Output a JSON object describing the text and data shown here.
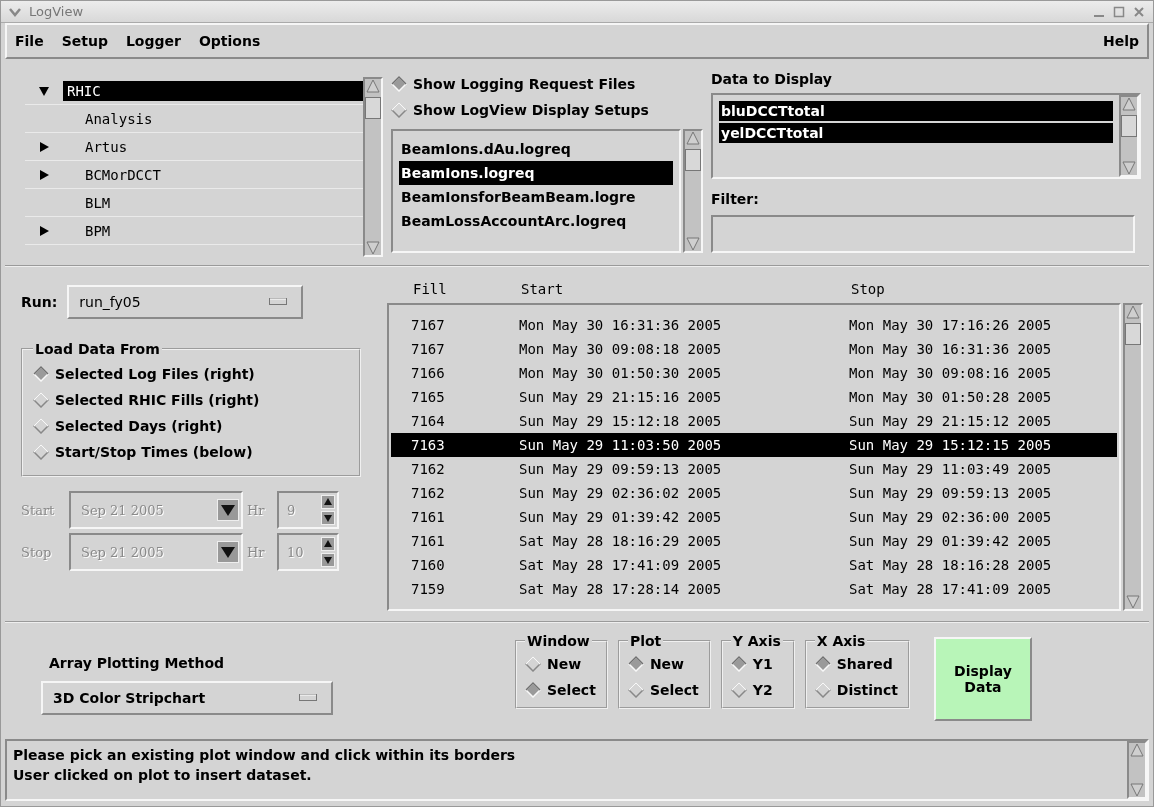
{
  "window": {
    "title": "LogView"
  },
  "menu": [
    {
      "label": "File"
    },
    {
      "label": "Setup"
    },
    {
      "label": "Logger"
    },
    {
      "label": "Options"
    }
  ],
  "help_menu": {
    "label": "Help"
  },
  "tree": [
    {
      "label": "RHIC",
      "selected": true,
      "expanded": true,
      "children": [
        {
          "label": "Analysis",
          "selected": false
        },
        {
          "label": "Artus",
          "selected": false,
          "expanded": false
        },
        {
          "label": "BCMorDCCT",
          "selected": false,
          "expanded": false
        },
        {
          "label": "BLM",
          "selected": false
        },
        {
          "label": "BPM",
          "selected": false,
          "expanded": false
        }
      ]
    }
  ],
  "source_options": [
    {
      "label": "Show Logging Request Files",
      "selected": true
    },
    {
      "label": "Show LogView Display Setups",
      "selected": false
    }
  ],
  "files": [
    {
      "label": "BeamIons.dAu.logreq",
      "selected": false
    },
    {
      "label": "BeamIons.logreq",
      "selected": true
    },
    {
      "label": "BeamIonsforBeamBeam.logre",
      "selected": false
    },
    {
      "label": "BeamLossAccountArc.logreq",
      "selected": false
    }
  ],
  "data_to_display": {
    "label": "Data to Display",
    "items": [
      {
        "label": "bluDCCTtotal",
        "selected": true
      },
      {
        "label": "yelDCCTtotal",
        "selected": true
      }
    ]
  },
  "filter": {
    "label": "Filter:"
  },
  "run": {
    "label": "Run:",
    "value": "run_fy05"
  },
  "load_data_from": {
    "title": "Load Data From",
    "options": [
      {
        "label": "Selected Log Files (right)",
        "selected": true
      },
      {
        "label": "Selected RHIC Fills (right)",
        "selected": false
      },
      {
        "label": "Selected Days (right)",
        "selected": false
      },
      {
        "label": "Start/Stop Times (below)",
        "selected": false
      }
    ]
  },
  "time_range": [
    {
      "label": "Start",
      "date": "Sep 21 2005",
      "hr_label": "Hr",
      "hour": "9",
      "disabled": true
    },
    {
      "label": "Stop",
      "date": "Sep 21 2005",
      "hr_label": "Hr",
      "hour": "10",
      "disabled": true
    }
  ],
  "fills": {
    "columns": [
      "Fill",
      "Start",
      "Stop"
    ],
    "rows": [
      {
        "fill": "7167",
        "start": "Mon May 30 16:31:36 2005",
        "stop": "Mon May 30 17:16:26 2005",
        "selected": false
      },
      {
        "fill": "7167",
        "start": "Mon May 30 09:08:18 2005",
        "stop": "Mon May 30 16:31:36 2005",
        "selected": false
      },
      {
        "fill": "7166",
        "start": "Mon May 30 01:50:30 2005",
        "stop": "Mon May 30 09:08:16 2005",
        "selected": false
      },
      {
        "fill": "7165",
        "start": "Sun May 29 21:15:16 2005",
        "stop": "Mon May 30 01:50:28 2005",
        "selected": false
      },
      {
        "fill": "7164",
        "start": "Sun May 29 15:12:18 2005",
        "stop": "Sun May 29 21:15:12 2005",
        "selected": false
      },
      {
        "fill": "7163",
        "start": "Sun May 29 11:03:50 2005",
        "stop": "Sun May 29 15:12:15 2005",
        "selected": true
      },
      {
        "fill": "7162",
        "start": "Sun May 29 09:59:13 2005",
        "stop": "Sun May 29 11:03:49 2005",
        "selected": false
      },
      {
        "fill": "7162",
        "start": "Sun May 29 02:36:02 2005",
        "stop": "Sun May 29 09:59:13 2005",
        "selected": false
      },
      {
        "fill": "7161",
        "start": "Sun May 29 01:39:42 2005",
        "stop": "Sun May 29 02:36:00 2005",
        "selected": false
      },
      {
        "fill": "7161",
        "start": "Sat May 28 18:16:29 2005",
        "stop": "Sun May 29 01:39:42 2005",
        "selected": false
      },
      {
        "fill": "7160",
        "start": "Sat May 28 17:41:09 2005",
        "stop": "Sat May 28 18:16:28 2005",
        "selected": false
      },
      {
        "fill": "7159",
        "start": "Sat May 28 17:28:14 2005",
        "stop": "Sat May 28 17:41:09 2005",
        "selected": false
      }
    ]
  },
  "array_plotting": {
    "label": "Array Plotting Method",
    "value": "3D Color Stripchart"
  },
  "option_groups": [
    {
      "title": "Window",
      "options": [
        {
          "label": "New",
          "selected": false
        },
        {
          "label": "Select",
          "selected": true
        }
      ]
    },
    {
      "title": "Plot",
      "options": [
        {
          "label": "New",
          "selected": true
        },
        {
          "label": "Select",
          "selected": false
        }
      ]
    },
    {
      "title": "Y Axis",
      "options": [
        {
          "label": "Y1",
          "selected": true
        },
        {
          "label": "Y2",
          "selected": false
        }
      ]
    },
    {
      "title": "X Axis",
      "options": [
        {
          "label": "Shared",
          "selected": true
        },
        {
          "label": "Distinct",
          "selected": false
        }
      ]
    }
  ],
  "display_button": {
    "label": "Display Data"
  },
  "status_lines": [
    "Please pick an existing plot window and click within its borders",
    "User clicked on plot to insert dataset."
  ]
}
